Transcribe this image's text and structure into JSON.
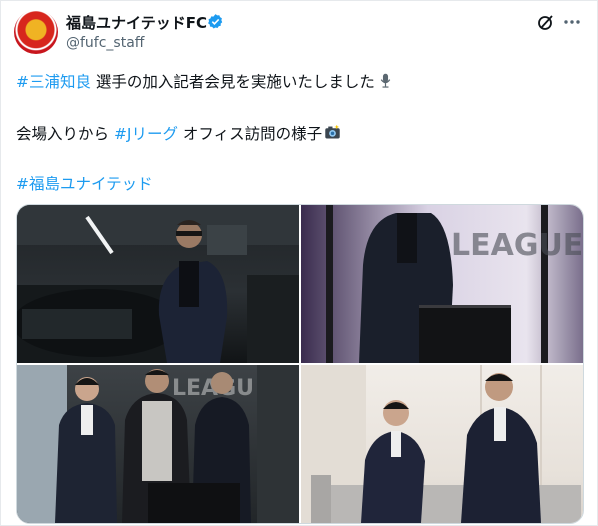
{
  "header": {
    "display_name": "福島ユナイテッドFC",
    "handle": "@fufc_staff"
  },
  "tweet": {
    "line1_hashtag": "#三浦知良",
    "line1_text": " 選手の加入記者会見を実施いたしました",
    "line2_prefix": "会場入りから ",
    "line2_hashtag": "#Jリーグ",
    "line2_suffix": " オフィス訪問の様子",
    "line3_hashtag": "#福島ユナイテッド"
  },
  "icons": {
    "verified": "verified-badge-icon",
    "grok": "grok-icon",
    "more": "more-icon",
    "microphone": "microphone-icon",
    "camera": "camera-flash-icon"
  },
  "colors": {
    "link": "#1d9bf0",
    "text": "#0f1419",
    "muted": "#536471"
  }
}
